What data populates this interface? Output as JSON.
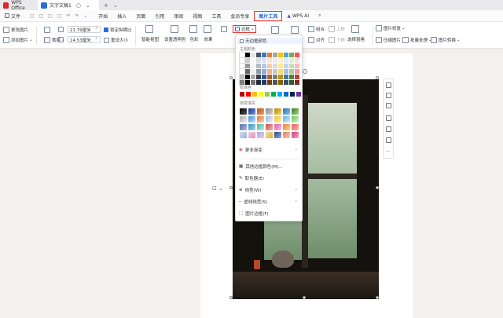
{
  "titlebar": {
    "tabs": [
      {
        "label": "WPS Office"
      },
      {
        "label": "文字文稿1"
      }
    ]
  },
  "menu": {
    "file": "文件",
    "items": [
      "开始",
      "插入",
      "页面",
      "引用",
      "审阅",
      "视图",
      "工具",
      "会员专享"
    ],
    "active": "图片工具",
    "ai": "WPS AI"
  },
  "ribbon": {
    "change_image": "更改图片",
    "add_image": "添加图片",
    "crop": "裁剪",
    "width": "21.79厘米",
    "height": "14.53厘米",
    "lock_ratio": "锁定纵横比",
    "reset_size": "重设大小",
    "smart_cutout": "智能抠图",
    "transparent": "设置透明色",
    "color": "色彩",
    "effect": "效果",
    "border": "边框",
    "group": "组合",
    "align": "对齐",
    "select_pane": "选择窗格",
    "move_up": "上移",
    "move_down": "下移",
    "rotate": "旋转",
    "image_repair": "图片修复",
    "compress": "压缩图片",
    "batch": "批量处理",
    "convert": "图片转换"
  },
  "dropdown": {
    "no_border_color": "无边框颜色",
    "theme_colors": "主题颜色",
    "standard_colors": "标准色",
    "gradient_fill": "渐变填充",
    "more_gradients": "更多渐变",
    "other_colors": "其他边框颜色(M)...",
    "eyedropper": "取色器(E)",
    "line_style": "线型(W)",
    "dash_style": "虚线线型(S)",
    "picture_border": "图片边框(F)"
  },
  "colors": {
    "theme_row": [
      "#ffffff",
      "#000000",
      "#e7e6e6",
      "#44546a",
      "#4472c4",
      "#ed7d31",
      "#a5a5a5",
      "#ffc000",
      "#5b9bd5",
      "#70ad47",
      "#ff4e50"
    ],
    "standard": [
      "#c00000",
      "#ff0000",
      "#ffc000",
      "#ffff00",
      "#92d050",
      "#00b050",
      "#00b0f0",
      "#0070c0",
      "#002060",
      "#7030a0"
    ]
  }
}
